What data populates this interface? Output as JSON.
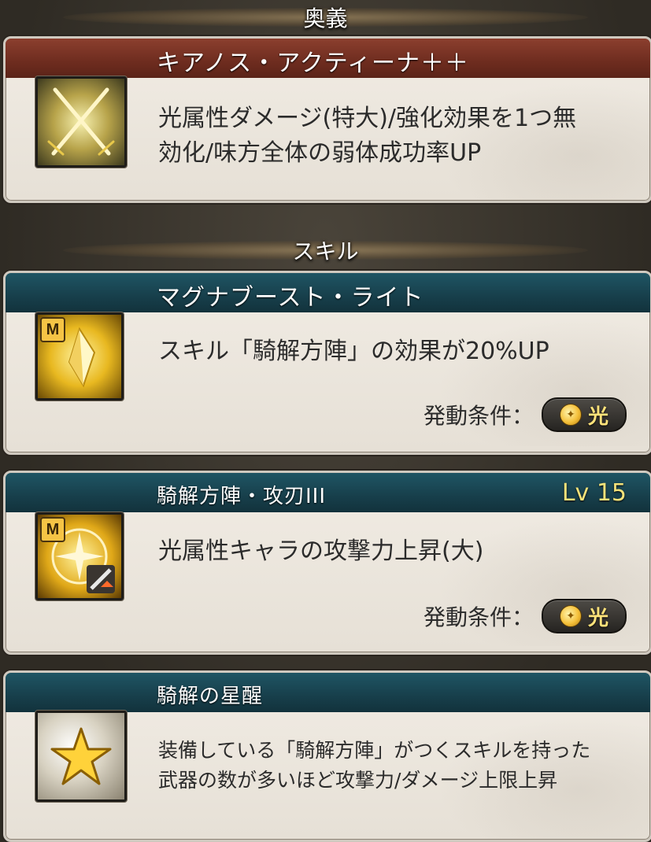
{
  "ougi": {
    "header": "奥義",
    "name": "キアノス・アクティーナ＋＋",
    "description": "光属性ダメージ(特大)/強化効果を1つ無\n効化/味方全体の弱体成功率UP",
    "icon": "crossed-swords-icon"
  },
  "skills_header": "スキル",
  "skills": [
    {
      "name": "マグナブースト・ライト",
      "badge": "M",
      "description": "スキル「騎解方陣」の効果が20%UP",
      "condition_label": "発動条件：",
      "element": "光",
      "icon": "light-crystal-icon"
    },
    {
      "name": "騎解方陣・攻刃III",
      "level": "Lv 15",
      "badge": "M",
      "description": "光属性キャラの攻撃力上昇(大)",
      "condition_label": "発動条件：",
      "element": "光",
      "icon": "light-attack-up-icon"
    },
    {
      "name": "騎解の星醒",
      "description": "装備している「騎解方陣」がつくスキルを持った\n武器の数が多いほど攻撃力/ダメージ上限上昇",
      "icon": "gold-star-icon"
    }
  ],
  "colors": {
    "ougi_banner": "#6e2c1f",
    "skill_banner": "#173f4b",
    "level_text": "#f3e27a",
    "light_element": "#ffe27a"
  }
}
